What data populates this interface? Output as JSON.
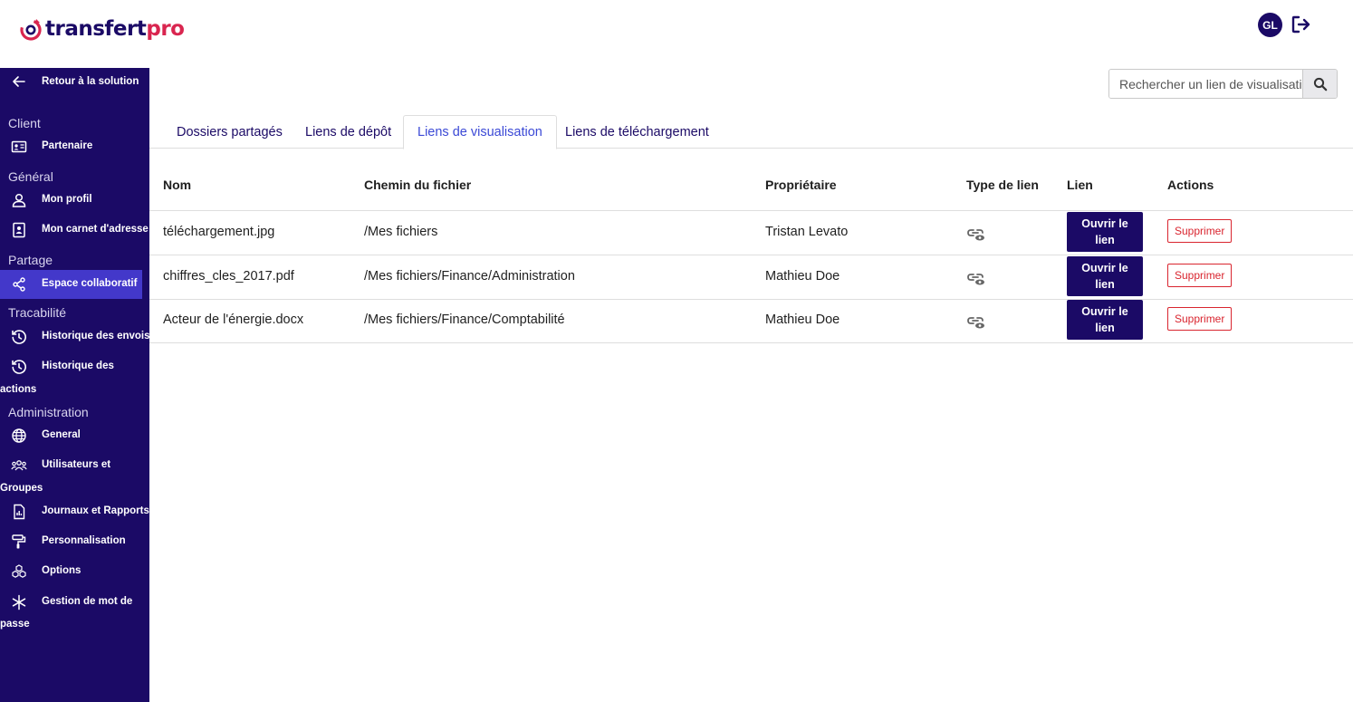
{
  "brand": {
    "name_part1": "transfert",
    "name_part2": "pro",
    "dark": "#1b0a66",
    "accent": "#d9254f"
  },
  "header": {
    "avatar_initials": "GL",
    "logout_icon": "logout-icon"
  },
  "sidebar": {
    "back_label": "Retour à la solution",
    "sections": {
      "client": "Client",
      "general": "Général",
      "partage": "Partage",
      "tracabilite": "Tracabilité",
      "administration": "Administration"
    },
    "items": {
      "partenaire": "Partenaire",
      "mon_profil": "Mon profil",
      "carnet": "Mon carnet d'adresse",
      "espace": "Espace collaboratif",
      "historique_envois": "Historique des envois",
      "historique_actions_1": "Historique des",
      "historique_actions_2": "actions",
      "general": "General",
      "utilisateurs_1": "Utilisateurs et",
      "utilisateurs_2": "Groupes",
      "journaux": "Journaux et Rapports",
      "personnalisation": "Personnalisation",
      "options": "Options",
      "mdp_1": "Gestion de mot de",
      "mdp_2": "passe"
    },
    "active_color": "#4338ca"
  },
  "search": {
    "placeholder": "Rechercher un lien de visualisation"
  },
  "tabs": [
    {
      "label": "Dossiers partagés"
    },
    {
      "label": "Liens de dépôt"
    },
    {
      "label": "Liens de visualisation",
      "active": true
    },
    {
      "label": "Liens de téléchargement"
    }
  ],
  "table": {
    "headers": {
      "nom": "Nom",
      "chemin": "Chemin du fichier",
      "proprietaire": "Propriétaire",
      "type": "Type de lien",
      "lien": "Lien",
      "actions": "Actions"
    },
    "rows": [
      {
        "nom": "téléchargement.jpg",
        "chemin": "/Mes fichiers",
        "proprietaire": "Tristan Levato",
        "open": "Ouvrir le lien",
        "delete": "Supprimer"
      },
      {
        "nom": "chiffres_cles_2017.pdf",
        "chemin": "/Mes fichiers/Finance/Administration",
        "proprietaire": "Mathieu Doe",
        "open": "Ouvrir le lien",
        "delete": "Supprimer"
      },
      {
        "nom": "Acteur de l'énergie.docx",
        "chemin": "/Mes fichiers/Finance/Comptabilité",
        "proprietaire": "Mathieu Doe",
        "open": "Ouvrir le lien",
        "delete": "Supprimer"
      }
    ]
  }
}
